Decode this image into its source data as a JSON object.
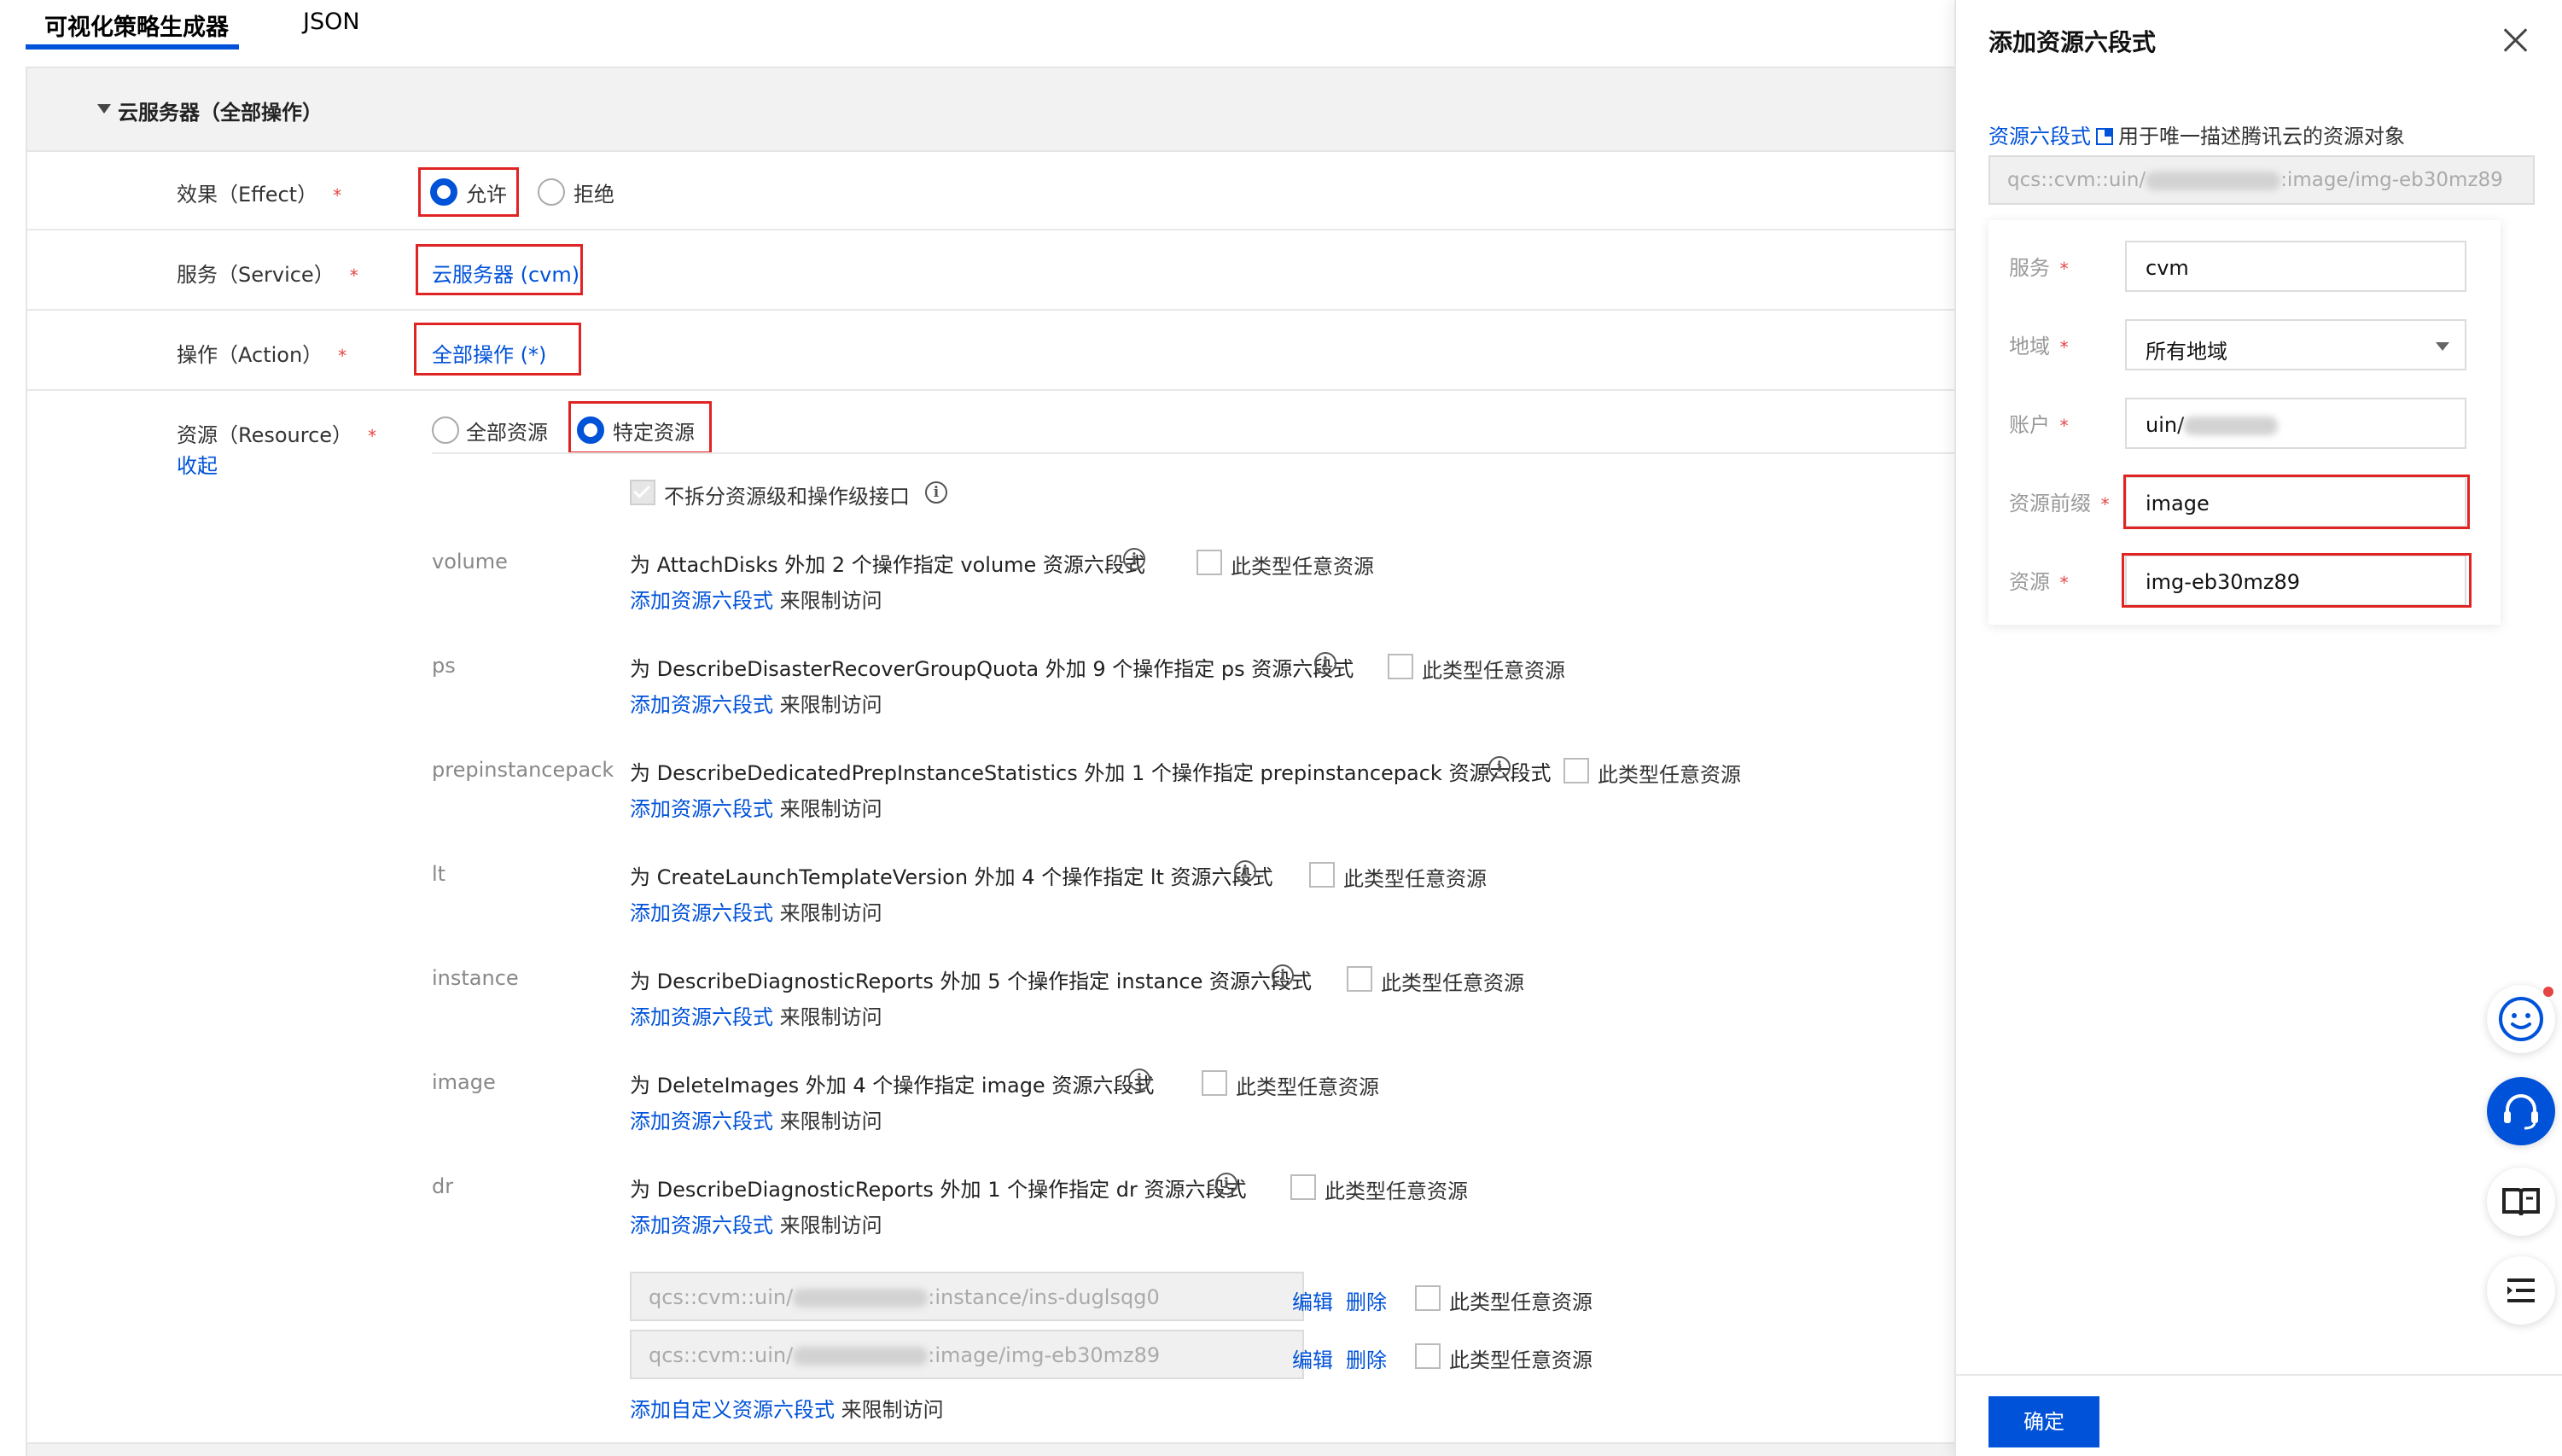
{
  "tabs": [
    {
      "label": "可视化策略生成器"
    },
    {
      "label": "JSON"
    }
  ],
  "section": {
    "title": "云服务器（全部操作）"
  },
  "effect": {
    "label": "效果（Effect）",
    "req": "*",
    "allow": "允许",
    "deny": "拒绝"
  },
  "service": {
    "label": "服务（Service）",
    "req": "*",
    "value": "云服务器 (cvm)"
  },
  "action": {
    "label": "操作（Action）",
    "req": "*",
    "value": "全部操作 (*)"
  },
  "resource": {
    "label": "资源（Resource）",
    "req": "*",
    "collapse": "收起",
    "all": "全部资源",
    "specific": "特定资源",
    "split_label": "不拆分资源级和操作级接口",
    "info": "i",
    "any_label": "此类型任意资源",
    "add_link": "添加资源六段式",
    "add_suffix": "来限制访问",
    "items": [
      {
        "name": "volume",
        "desc": "为 AttachDisks 外加 2 个操作指定 volume 资源六段式"
      },
      {
        "name": "ps",
        "desc": "为 DescribeDisasterRecoverGroupQuota 外加 9 个操作指定 ps 资源六段式"
      },
      {
        "name": "prepinstancepack",
        "desc": "为 DescribeDedicatedPrepInstanceStatistics 外加 1 个操作指定 prepinstancepack 资源六段式"
      },
      {
        "name": "lt",
        "desc": "为 CreateLaunchTemplateVersion 外加 4 个操作指定 lt 资源六段式"
      },
      {
        "name": "instance",
        "desc": "为 DescribeDiagnosticReports 外加 5 个操作指定 instance 资源六段式"
      },
      {
        "name": "image",
        "desc": "为 DeleteImages 外加 4 个操作指定 image 资源六段式"
      },
      {
        "name": "dr",
        "desc": "为 DescribeDiagnosticReports 外加 1 个操作指定 dr 资源六段式"
      }
    ],
    "qcs_entries": [
      {
        "prefix": "qcs::cvm::uin/",
        "suffix": ":instance/ins-duglsqg0"
      },
      {
        "prefix": "qcs::cvm::uin/",
        "suffix": ":image/img-eb30mz89"
      }
    ],
    "edit": "编辑",
    "delete": "删除",
    "add_custom_link": "添加自定义资源六段式",
    "add_custom_suffix": "来限制访问"
  },
  "drawer": {
    "title": "添加资源六段式",
    "hint_link": "资源六段式",
    "hint_text": "用于唯一描述腾讯云的资源对象",
    "preview_prefix": "qcs::cvm::uin/",
    "preview_suffix": ":image/img-eb30mz89",
    "fields": [
      {
        "label": "服务",
        "req": "*",
        "value": "cvm"
      },
      {
        "label": "地域",
        "req": "*",
        "value": "所有地域"
      },
      {
        "label": "账户",
        "req": "*",
        "value": "uin/"
      },
      {
        "label": "资源前缀",
        "req": "*",
        "value": "image"
      },
      {
        "label": "资源",
        "req": "*",
        "value": "img-eb30mz89"
      }
    ],
    "confirm": "确定"
  }
}
